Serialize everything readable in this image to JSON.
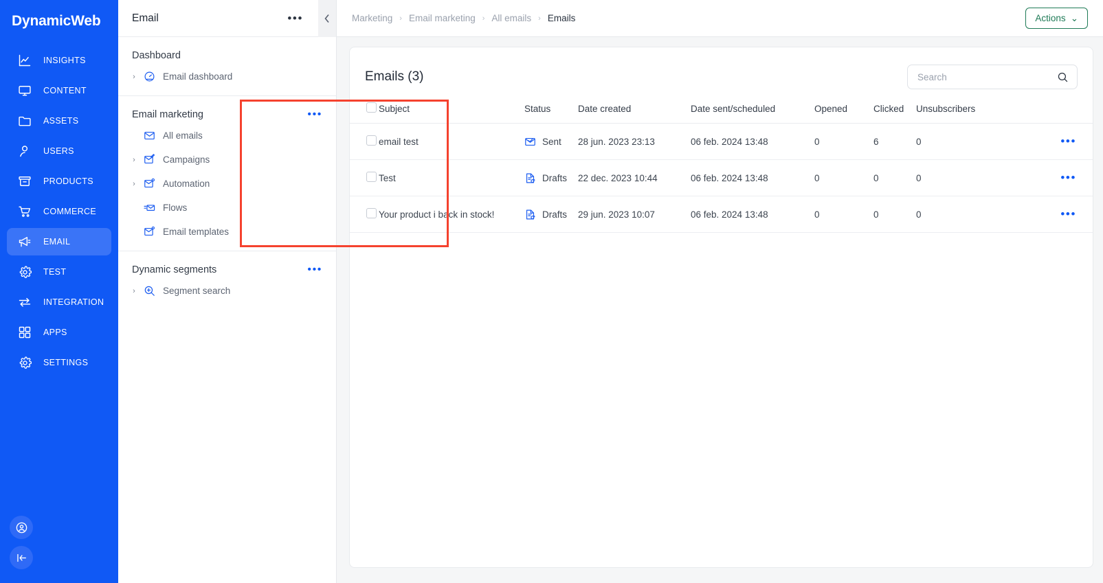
{
  "brand": {
    "name": "DynamicWeb"
  },
  "rail": {
    "items": [
      {
        "label": "INSIGHTS",
        "icon": "insights-chart-icon",
        "active": false
      },
      {
        "label": "CONTENT",
        "icon": "monitor-icon",
        "active": false
      },
      {
        "label": "ASSETS",
        "icon": "folder-icon",
        "active": false
      },
      {
        "label": "USERS",
        "icon": "person-icon",
        "active": false
      },
      {
        "label": "PRODUCTS",
        "icon": "box-icon",
        "active": false
      },
      {
        "label": "COMMERCE",
        "icon": "cart-icon",
        "active": false
      },
      {
        "label": "EMAIL",
        "icon": "megaphone-icon",
        "active": true
      },
      {
        "label": "TEST",
        "icon": "gear-icon",
        "active": false
      },
      {
        "label": "INTEGRATION",
        "icon": "exchange-arrows-icon",
        "active": false
      },
      {
        "label": "APPS",
        "icon": "grid-squares-icon",
        "active": false
      },
      {
        "label": "SETTINGS",
        "icon": "gear-icon",
        "active": false
      }
    ],
    "bottom": [
      {
        "icon": "user-account-icon"
      },
      {
        "icon": "collapse-left-icon"
      }
    ]
  },
  "panel": {
    "title": "Email",
    "more_label": "•••",
    "collapse_icon": "chevron-left-icon",
    "groups": [
      {
        "title": "Dashboard",
        "has_more": false,
        "highlighted": false,
        "items": [
          {
            "label": "Email dashboard",
            "icon": "gauge-icon",
            "caret": true
          }
        ]
      },
      {
        "title": "Email marketing",
        "has_more": true,
        "more_label": "•••",
        "highlighted": true,
        "items": [
          {
            "label": "All emails",
            "icon": "envelope-icon",
            "caret": false
          },
          {
            "label": "Campaigns",
            "icon": "envelope-edit-icon",
            "caret": true
          },
          {
            "label": "Automation",
            "icon": "envelope-gear-icon",
            "caret": true
          },
          {
            "label": "Flows",
            "icon": "envelope-flow-icon",
            "caret": false
          },
          {
            "label": "Email templates",
            "icon": "envelope-template-icon",
            "caret": false
          }
        ]
      },
      {
        "title": "Dynamic segments",
        "has_more": true,
        "more_label": "•••",
        "highlighted": false,
        "items": [
          {
            "label": "Segment search",
            "icon": "magnifier-plus-icon",
            "caret": true
          }
        ]
      }
    ]
  },
  "topbar": {
    "breadcrumb": [
      "Marketing",
      "Email marketing",
      "All emails",
      "Emails"
    ],
    "separator": "›",
    "actions_label": "Actions",
    "actions_caret": "⌄"
  },
  "main": {
    "card_title": "Emails (3)",
    "search": {
      "placeholder": "Search",
      "value": "",
      "icon": "search-icon"
    },
    "table": {
      "columns": [
        "Subject",
        "Status",
        "Date created",
        "Date sent/scheduled",
        "Opened",
        "Clicked",
        "Unsubscribers"
      ],
      "rows": [
        {
          "subject": "email test",
          "status": "Sent",
          "status_icon": "envelope-check-icon",
          "date_created": "28 jun. 2023 23:13",
          "date_sent": "06 feb. 2024 13:48",
          "opened": "0",
          "clicked": "6",
          "unsubscribers": "0",
          "menu": "•••"
        },
        {
          "subject": "Test",
          "status": "Drafts",
          "status_icon": "document-edit-icon",
          "date_created": "22 dec. 2023 10:44",
          "date_sent": "06 feb. 2024 13:48",
          "opened": "0",
          "clicked": "0",
          "unsubscribers": "0",
          "menu": "•••"
        },
        {
          "subject": "Your product i back in stock!",
          "status": "Drafts",
          "status_icon": "document-edit-icon",
          "date_created": "29 jun. 2023 10:07",
          "date_sent": "06 feb. 2024 13:48",
          "opened": "0",
          "clicked": "0",
          "unsubscribers": "0",
          "menu": "•••"
        }
      ]
    }
  },
  "colors": {
    "brand_blue": "#1059f5",
    "active_blue": "#3a74f7",
    "icon_blue": "#1b5cf0",
    "highlight_red": "#f5422e",
    "actions_green": "#1e7a56"
  }
}
